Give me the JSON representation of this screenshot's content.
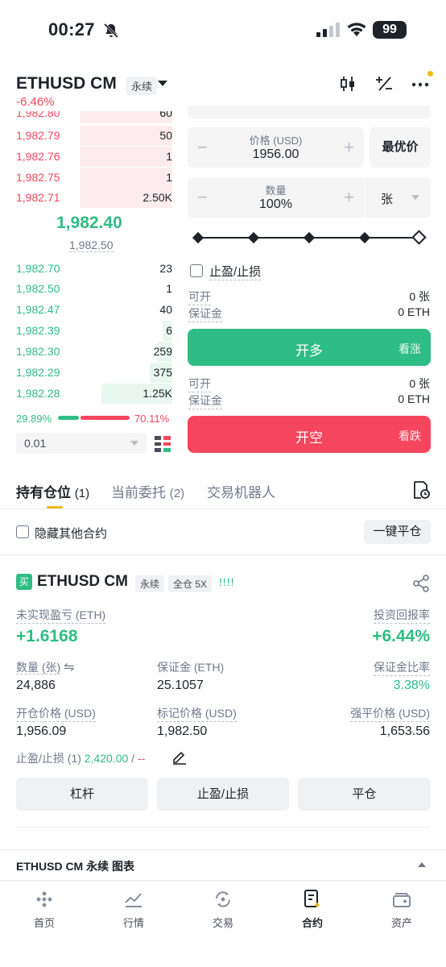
{
  "status_bar": {
    "time": "00:27",
    "battery": "99"
  },
  "header": {
    "symbol": "ETHUSD CM",
    "contract_type": "永续",
    "change": "-6.46%"
  },
  "orderbook": {
    "asks": [
      {
        "price": "1,982.80",
        "qty": "60"
      },
      {
        "price": "1,982.79",
        "qty": "50"
      },
      {
        "price": "1,982.76",
        "qty": "1"
      },
      {
        "price": "1,982.75",
        "qty": "1"
      },
      {
        "price": "1,982.71",
        "qty": "2.50K"
      }
    ],
    "last_price": "1,982.40",
    "mark_price": "1,982.50",
    "bids": [
      {
        "price": "1,982.70",
        "qty": "23"
      },
      {
        "price": "1,982.50",
        "qty": "1"
      },
      {
        "price": "1,982.47",
        "qty": "40"
      },
      {
        "price": "1,982.39",
        "qty": "6"
      },
      {
        "price": "1,982.30",
        "qty": "259"
      },
      {
        "price": "1,982.29",
        "qty": "375"
      },
      {
        "price": "1,982.28",
        "qty": "1.25K"
      }
    ],
    "buy_ratio": "29.89%",
    "sell_ratio": "70.11%",
    "depth": "0.01"
  },
  "order_form": {
    "price_label": "价格 (USD)",
    "price_value": "1956.00",
    "best_price": "最优价",
    "qty_label": "数量",
    "qty_value": "100%",
    "unit": "张",
    "tpsl": "止盈/止损",
    "long": {
      "avail_label": "可开",
      "avail_value": "0 张",
      "margin_label": "保证金",
      "margin_value": "0 ETH",
      "button": "开多",
      "side": "看涨"
    },
    "short": {
      "avail_label": "可开",
      "avail_value": "0 张",
      "margin_label": "保证金",
      "margin_value": "0 ETH",
      "button": "开空",
      "side": "看跌"
    }
  },
  "tabs": {
    "positions": "持有仓位",
    "positions_count": "(1)",
    "orders": "当前委托",
    "orders_count": "(2)",
    "bots": "交易机器人"
  },
  "filters": {
    "hide_others": "隐藏其他合约",
    "close_all": "一键平仓"
  },
  "position": {
    "side_tag": "买",
    "symbol": "ETHUSD CM",
    "type": "永续",
    "margin_mode": "全仓 5X",
    "bars": "!!!!",
    "pnl_label": "未实现盈亏 (ETH)",
    "pnl_value": "+1.6168",
    "roe_label": "投资回报率",
    "roe_value": "+6.44%",
    "size_label": "数量 (张)",
    "size_swap": "⇋",
    "size_value": "24,886",
    "margin_label": "保证金 (ETH)",
    "margin_value": "25.1057",
    "margin_ratio_label": "保证金比率",
    "margin_ratio_value": "3.38%",
    "entry_label": "开仓价格 (USD)",
    "entry_value": "1,956.09",
    "mark_label": "标记价格 (USD)",
    "mark_value": "1,982.50",
    "liq_label": "强平价格 (USD)",
    "liq_value": "1,653.56",
    "tpsl_label": "止盈/止损 (1)",
    "tp_value": "2,420.00",
    "sep": "/",
    "sl_value": "--",
    "btn_leverage": "杠杆",
    "btn_tpsl": "止盈/止损",
    "btn_close": "平仓"
  },
  "chart_bar": {
    "label": "ETHUSD CM 永续 图表"
  },
  "bottom_nav": {
    "home": "首页",
    "markets": "行情",
    "trade": "交易",
    "futures": "合约",
    "assets": "资产"
  },
  "colors": {
    "green": "#2ebd85",
    "red": "#f6465d",
    "accent": "#f0b90b"
  }
}
